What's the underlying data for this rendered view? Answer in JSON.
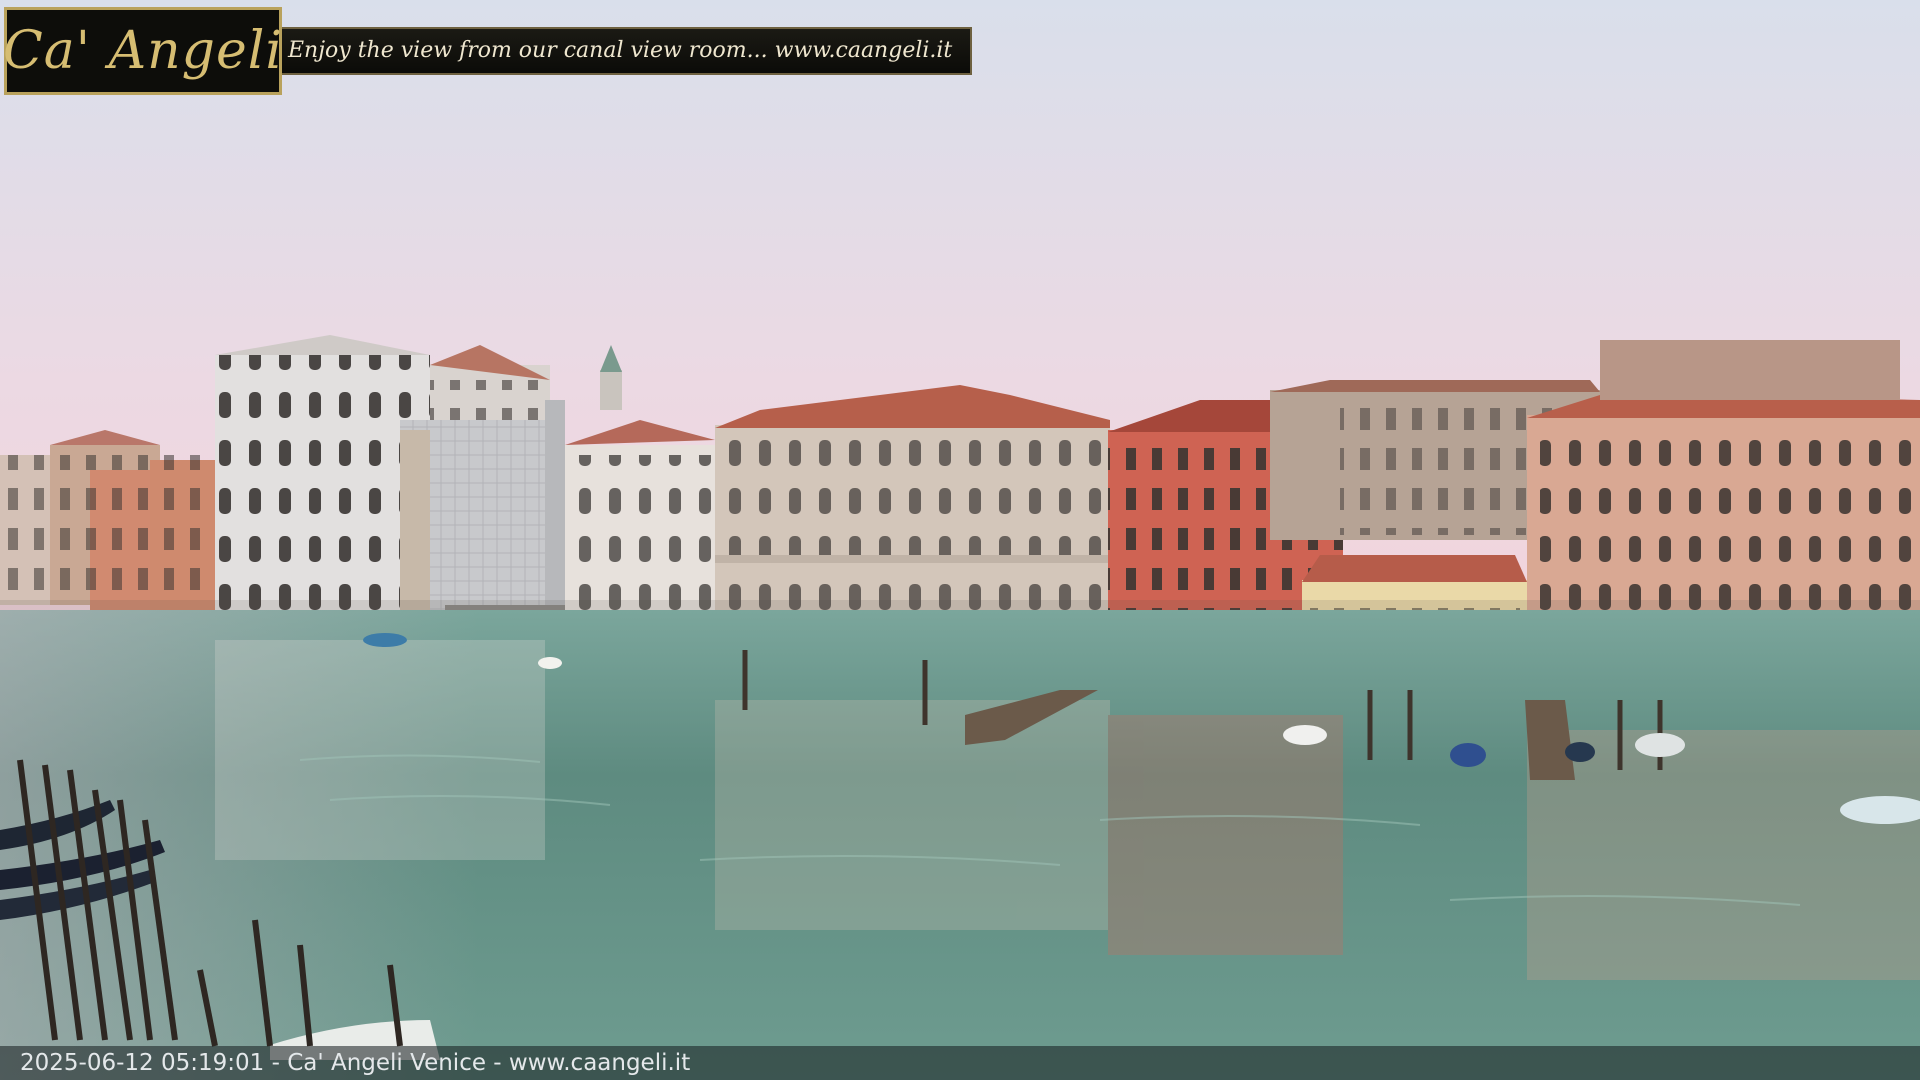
{
  "overlay": {
    "logo": "Ca' Angeli",
    "tagline": "Enjoy the view from our canal view room... www.caangeli.it",
    "timestamp": "2025-06-12 05:19:01 - Ca' Angeli Venice - www.caangeli.it"
  },
  "colors": {
    "sky_top": "#d6dde8",
    "sky_horizon": "#f2d6de",
    "water": "#5f8f84",
    "brick_red": "#c0574a",
    "roof_tile": "#b4604c"
  }
}
